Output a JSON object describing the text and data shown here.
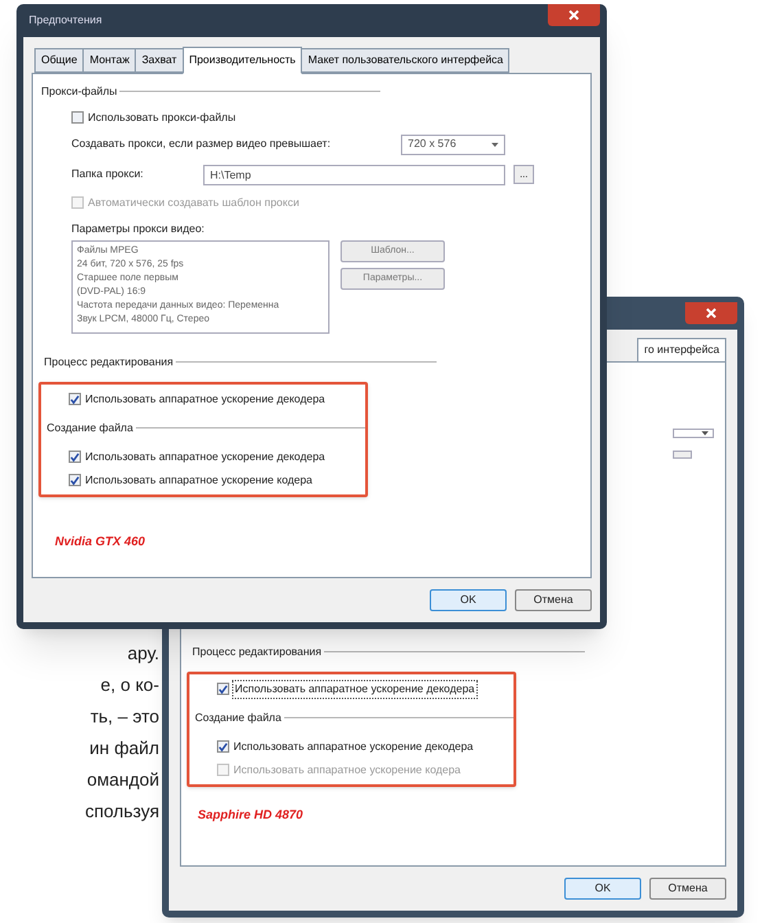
{
  "article_fragments": [
    "ару.",
    "е, о ко-",
    "ть, – это",
    "ин файл",
    "омандой",
    "спользуя"
  ],
  "back_dialog": {
    "tab_fragment": "го интерфейса",
    "sections": [
      {
        "title": "Процесс редактирования",
        "options": [
          {
            "label": "Использовать аппаратное ускорение декодера",
            "checked": true,
            "disabled": false,
            "focused": true
          }
        ]
      },
      {
        "title": "Создание файла",
        "options": [
          {
            "label": "Использовать аппаратное ускорение декодера",
            "checked": true,
            "disabled": false,
            "focused": false
          },
          {
            "label": "Использовать аппаратное ускорение кодера",
            "checked": false,
            "disabled": true,
            "focused": false
          }
        ]
      }
    ],
    "caption": "Sapphire HD 4870",
    "buttons": [
      "OK",
      "Отмена"
    ]
  },
  "front_dialog": {
    "title": "Предпочтения",
    "tabs": [
      {
        "label": "Общие",
        "selected": false
      },
      {
        "label": "Монтаж",
        "selected": false
      },
      {
        "label": "Захват",
        "selected": false
      },
      {
        "label": "Производительность",
        "selected": true
      },
      {
        "label": "Макет пользовательского интерфейса",
        "selected": false
      }
    ],
    "proxy": {
      "title": "Прокси-файлы",
      "use_proxy": {
        "label": "Использовать прокси-файлы",
        "checked": false,
        "disabled": false
      },
      "size_label": "Создавать прокси, если размер видео превышает:",
      "size_value": "720 x 576",
      "folder_label": "Папка прокси:",
      "folder_value": "H:\\Temp",
      "browse": "...",
      "auto_template": {
        "label": "Автоматически создавать шаблон прокси",
        "checked": false,
        "disabled": true
      },
      "params_label": "Параметры прокси видео:",
      "params_lines": [
        "Файлы MPEG",
        "24 бит, 720 x 576, 25 fps",
        "Старшее поле первым",
        "(DVD-PAL) 16:9",
        "Частота передачи данных видео: Переменна",
        "Звук LPCM, 48000 Гц, Стерео"
      ],
      "side_buttons": [
        "Шаблон...",
        "Параметры..."
      ]
    },
    "sections": [
      {
        "title": "Процесс редактирования",
        "options": [
          {
            "label": "Использовать аппаратное ускорение декодера",
            "checked": true,
            "disabled": false,
            "focused": false
          }
        ]
      },
      {
        "title": "Создание файла",
        "options": [
          {
            "label": "Использовать аппаратное ускорение декодера",
            "checked": true,
            "disabled": false,
            "focused": false
          },
          {
            "label": "Использовать аппаратное ускорение кодера",
            "checked": true,
            "disabled": false,
            "focused": false
          }
        ]
      }
    ],
    "caption": "Nvidia GTX 460",
    "buttons": [
      "OK",
      "Отмена"
    ]
  }
}
